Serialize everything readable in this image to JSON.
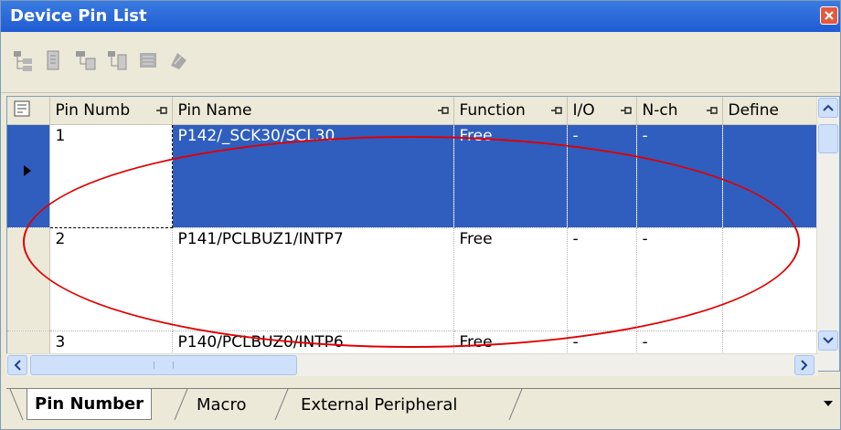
{
  "window": {
    "title": "Device Pin List"
  },
  "grid": {
    "columns": [
      {
        "label": ""
      },
      {
        "label": "Pin Numb"
      },
      {
        "label": "Pin Name"
      },
      {
        "label": "Function"
      },
      {
        "label": "I/O"
      },
      {
        "label": "N-ch"
      },
      {
        "label": "Define"
      }
    ],
    "rows": [
      {
        "pin_number": "1",
        "pin_name": "P142/_SCK30/SCL30",
        "function": "Free",
        "io": "-",
        "nch": "-",
        "define": ""
      },
      {
        "pin_number": "2",
        "pin_name": "P141/PCLBUZ1/INTP7",
        "function": "Free",
        "io": "-",
        "nch": "-",
        "define": ""
      },
      {
        "pin_number": "3",
        "pin_name": "P140/PCLBUZ0/INTP6",
        "function": "Free",
        "io": "-",
        "nch": "-",
        "define": ""
      }
    ]
  },
  "tabs": [
    {
      "label": "Pin Number"
    },
    {
      "label": "Macro"
    },
    {
      "label": "External Peripheral"
    }
  ]
}
